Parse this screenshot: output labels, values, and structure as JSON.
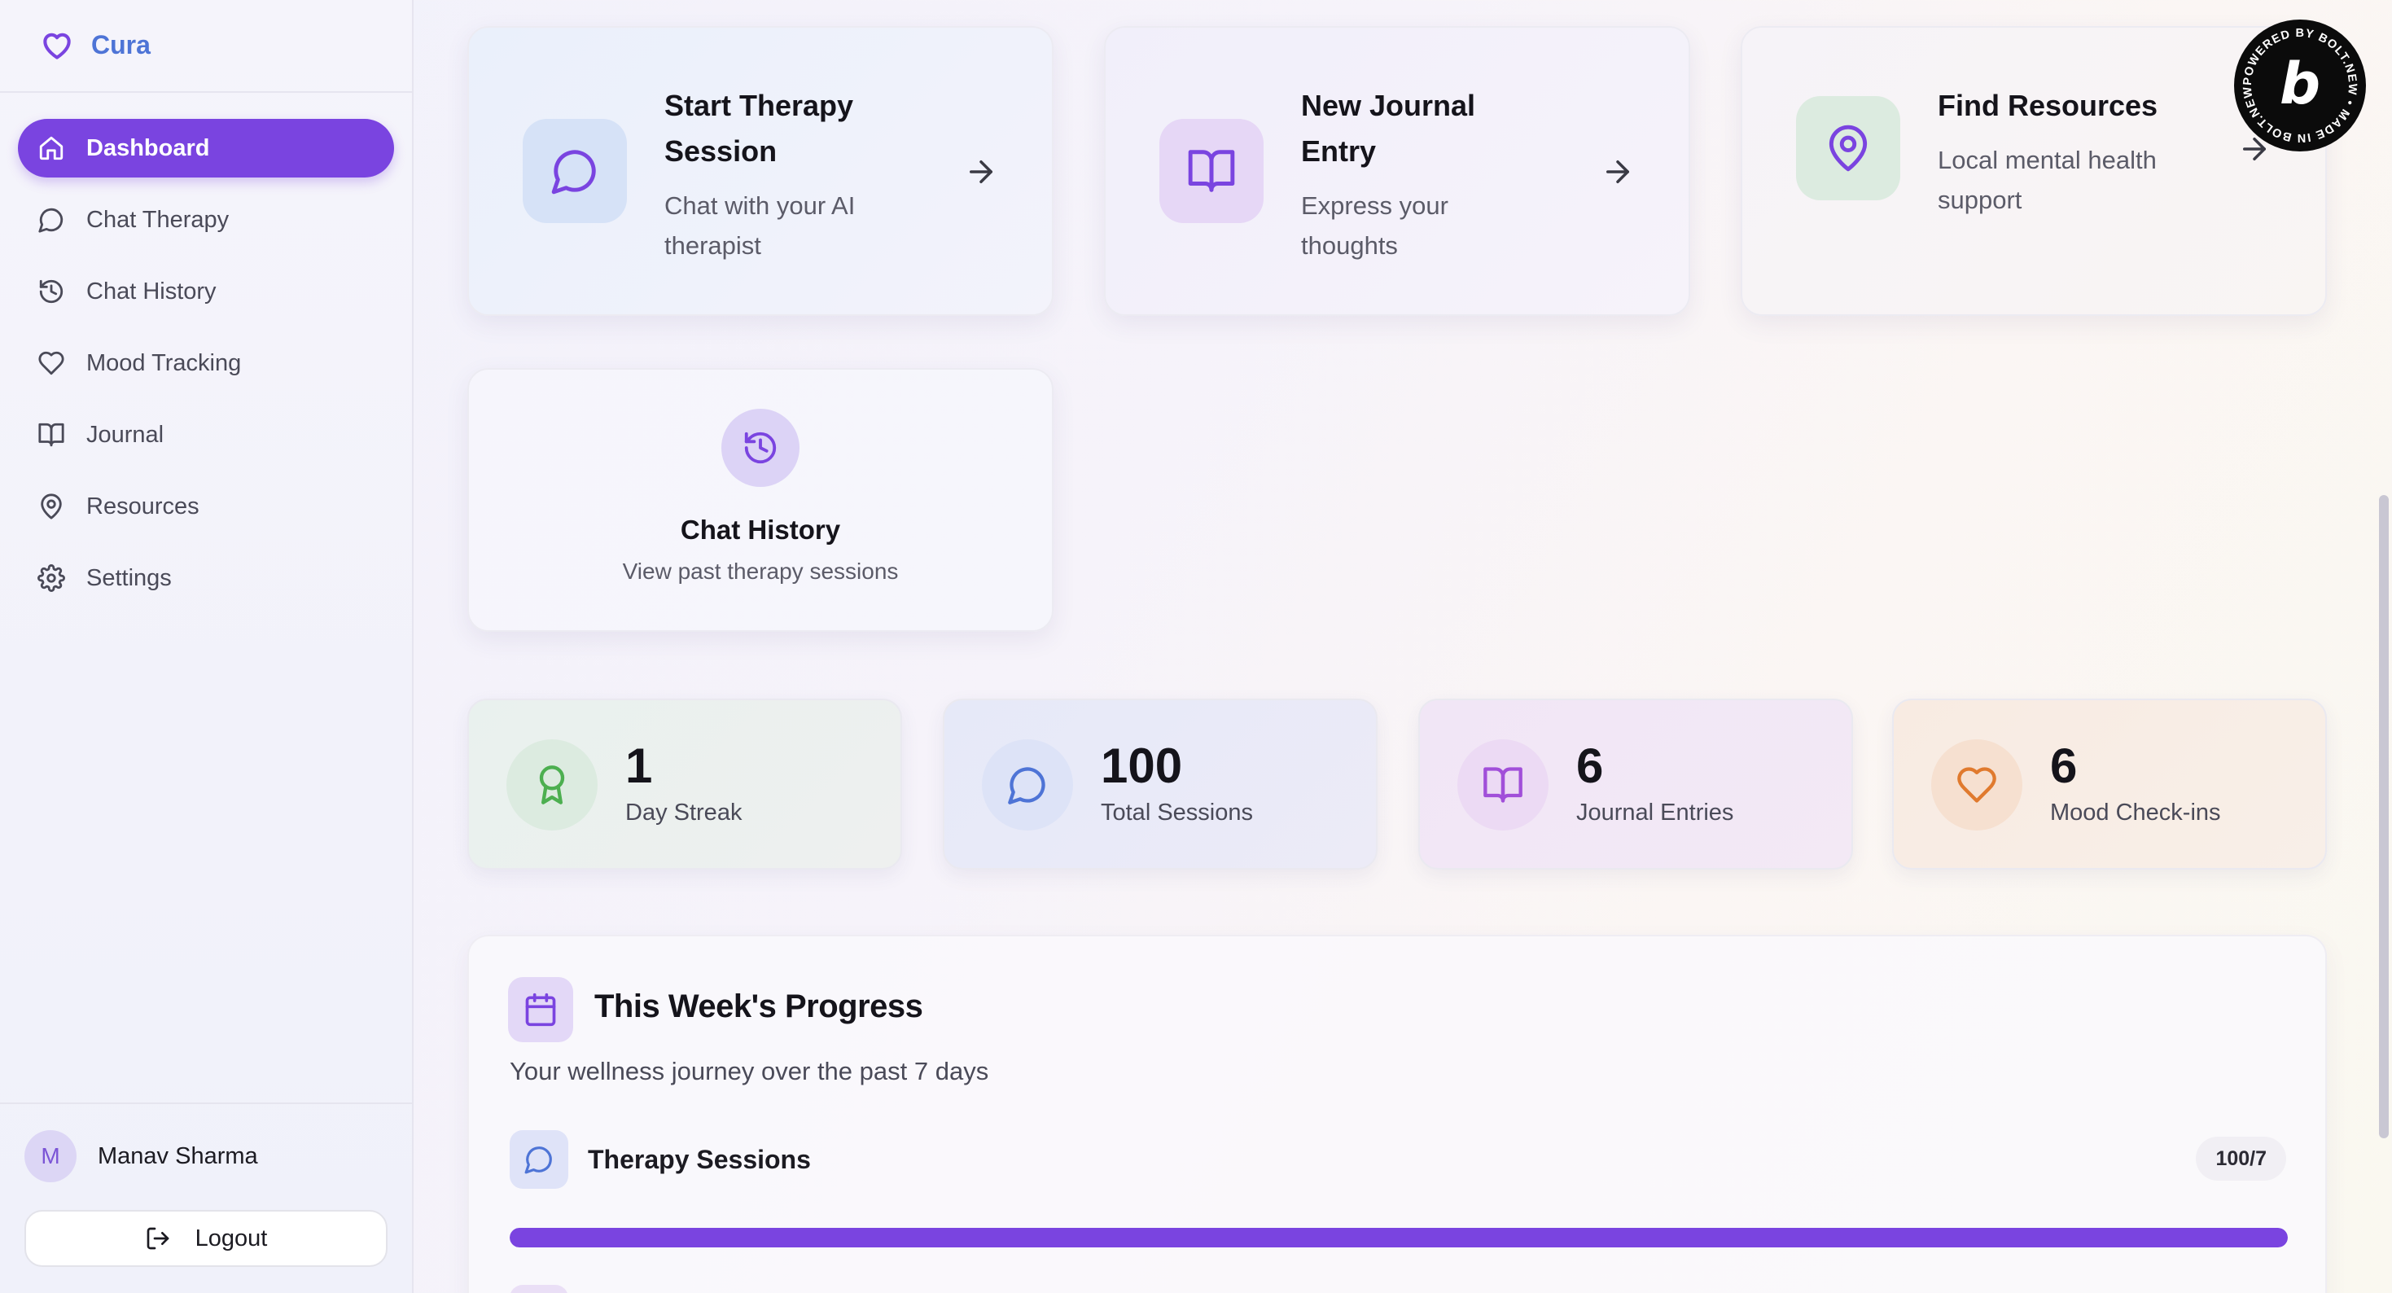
{
  "app": {
    "name": "Cura"
  },
  "sidebar": {
    "items": [
      {
        "label": "Dashboard",
        "icon": "home-icon",
        "active": true
      },
      {
        "label": "Chat Therapy",
        "icon": "chat-bubble-icon"
      },
      {
        "label": "Chat History",
        "icon": "history-icon"
      },
      {
        "label": "Mood Tracking",
        "icon": "heart-icon"
      },
      {
        "label": "Journal",
        "icon": "book-open-icon"
      },
      {
        "label": "Resources",
        "icon": "map-pin-icon"
      },
      {
        "label": "Settings",
        "icon": "gear-icon"
      }
    ],
    "user": {
      "initial": "M",
      "name": "Manav Sharma"
    },
    "logout_label": "Logout"
  },
  "quick_actions": [
    {
      "title_line1": "Start Therapy",
      "title_line2": "Session",
      "desc_line1": "Chat with your AI",
      "desc_line2": "therapist",
      "icon": "chat-bubble-icon"
    },
    {
      "title_line1": "New Journal",
      "title_line2": "Entry",
      "desc_line1": "Express your",
      "desc_line2": "thoughts",
      "icon": "book-open-icon"
    },
    {
      "title_line1": "Find Resources",
      "desc_line1": "Local mental health",
      "desc_line2": "support",
      "icon": "map-pin-icon"
    }
  ],
  "history_card": {
    "title": "Chat History",
    "desc": "View past therapy sessions",
    "icon": "history-icon"
  },
  "stats": [
    {
      "value": "1",
      "label": "Day Streak",
      "icon": "award-icon",
      "color": "#4caf50"
    },
    {
      "value": "100",
      "label": "Total Sessions",
      "icon": "chat-bubble-icon",
      "color": "#4e74d6"
    },
    {
      "value": "6",
      "label": "Journal Entries",
      "icon": "book-open-icon",
      "color": "#a14fd9"
    },
    {
      "value": "6",
      "label": "Mood Check-ins",
      "icon": "heart-icon",
      "color": "#e07a2e"
    }
  ],
  "progress": {
    "title": "This Week's Progress",
    "subtitle": "Your wellness journey over the past 7 days",
    "rows": [
      {
        "label": "Therapy Sessions",
        "badge": "100/7",
        "fill_percent": 100,
        "icon": "chat-bubble-icon"
      }
    ]
  },
  "badge": {
    "text": "POWERED BY BOLT.NEW • MADE IN BOLT.NEW •",
    "letter": "b"
  },
  "colors": {
    "accent": "#7a44e0",
    "brand": "#4e74d6"
  }
}
